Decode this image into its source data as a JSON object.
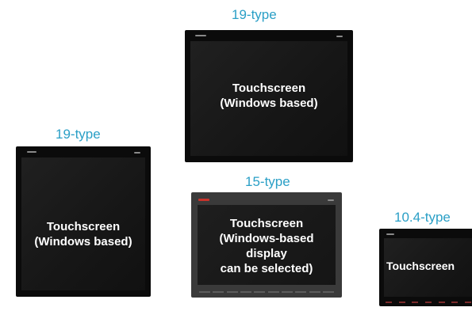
{
  "products": [
    {
      "caption": "19-type",
      "label": "Touchscreen\n(Windows based)"
    },
    {
      "caption": "19-type",
      "label": "Touchscreen\n(Windows based)"
    },
    {
      "caption": "15-type",
      "label": "Touchscreen\n(Windows-based\ndisplay\ncan be selected)"
    },
    {
      "caption": "10.4-type",
      "label": "Touchscreen"
    }
  ],
  "colors": {
    "caption": "#2a9fc6",
    "bezel_black": "#0b0b0b",
    "bezel_gray": "#3a3a3a",
    "label": "#ffffff"
  }
}
